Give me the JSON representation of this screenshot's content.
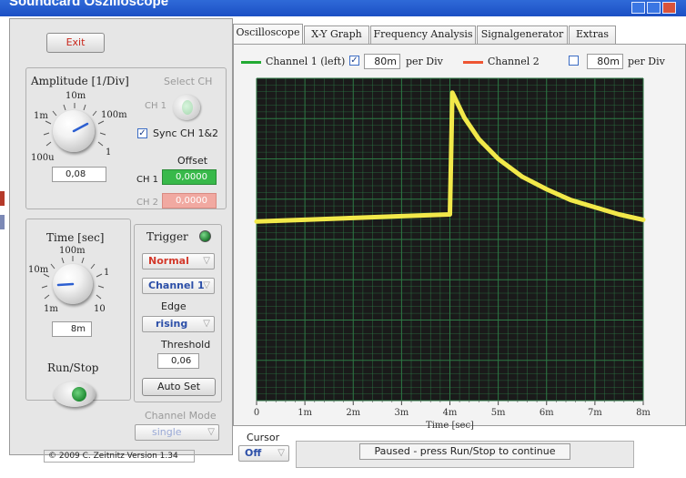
{
  "window": {
    "title": "Soundcard Oszilloscope"
  },
  "left": {
    "exit_label": "Exit",
    "amplitude": {
      "title": "Amplitude [1/Div]",
      "ticks": [
        "10m",
        "1m",
        "100m",
        "100u",
        "1"
      ],
      "value": "0,08"
    },
    "select_ch": {
      "title": "Select CH",
      "ch1_label": "CH 1"
    },
    "sync": {
      "label": "Sync CH 1&2",
      "checked": true
    },
    "offset": {
      "title": "Offset",
      "ch1_label": "CH 1",
      "ch1_value": "0,0000",
      "ch2_label": "CH 2",
      "ch2_value": "0,0000"
    },
    "time": {
      "title": "Time [sec]",
      "ticks": [
        "100m",
        "10m",
        "1",
        "1m",
        "10"
      ],
      "value": "8m"
    },
    "trigger": {
      "title": "Trigger",
      "mode": "Normal",
      "channel": "Channel 1",
      "edge_title": "Edge",
      "edge": "rising",
      "threshold_title": "Threshold",
      "threshold_value": "0,06",
      "autoset_label": "Auto Set"
    },
    "runstop_label": "Run/Stop",
    "channel_mode": {
      "title": "Channel Mode",
      "value": "single"
    },
    "footer_text": "© 2009 C. Zeitnitz Version 1.34"
  },
  "tabs": [
    "Oscilloscope",
    "X-Y Graph",
    "Frequency Analysis",
    "Signalgenerator",
    "Extras"
  ],
  "legend": {
    "ch1_label": "Channel 1 (left)",
    "ch1_per_div": "80m",
    "per_div_label": "per Div",
    "ch2_label": "Channel 2",
    "ch2_per_div": "80m",
    "per_div_label2": "per Div",
    "ch1_color": "#22aa33",
    "ch2_color": "#ee5533"
  },
  "bottom": {
    "cursor_title": "Cursor",
    "cursor_value": "Off",
    "status": "Paused - press Run/Stop to continue"
  },
  "chart_data": {
    "type": "line",
    "xlabel": "Time [sec]",
    "x_ticks": [
      "0",
      "1m",
      "2m",
      "3m",
      "4m",
      "5m",
      "6m",
      "7m",
      "8m"
    ],
    "xlim": [
      0,
      8
    ],
    "grid": true,
    "background": "#1a1a1a",
    "grid_color": "#2d7a45",
    "series": [
      {
        "color": "#f2e94a",
        "x": [
          0,
          1,
          2,
          3,
          4,
          4,
          4.05,
          4.3,
          4.6,
          5.0,
          5.5,
          6.0,
          6.5,
          7.0,
          7.5,
          8.0
        ],
        "y": [
          0.0,
          0.05,
          0.1,
          0.15,
          0.2,
          0.2,
          3.6,
          2.9,
          2.3,
          1.75,
          1.25,
          0.9,
          0.6,
          0.4,
          0.2,
          0.05
        ]
      }
    ],
    "ylim": [
      -5,
      4
    ]
  }
}
